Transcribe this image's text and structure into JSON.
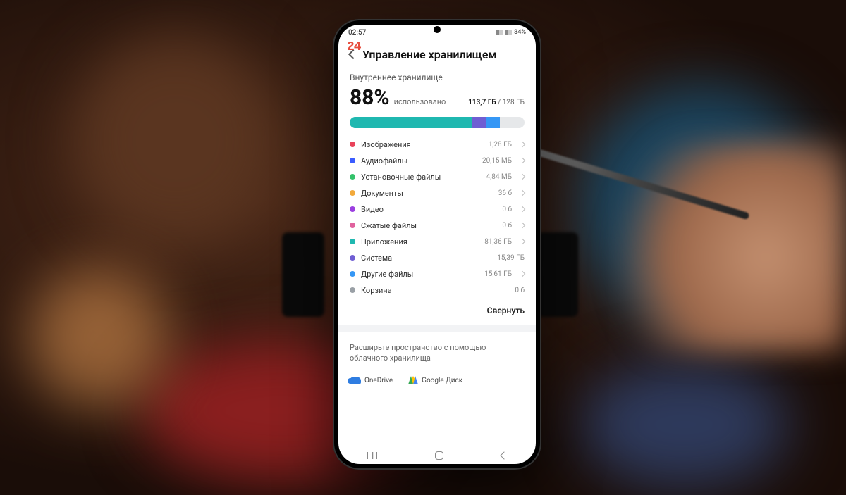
{
  "status_bar": {
    "time": "02:57",
    "battery_text": "84%"
  },
  "overlay_number": "24",
  "page_title": "Управление хранилищем",
  "storage": {
    "section_label": "Внутреннее хранилище",
    "percent": "88%",
    "percent_label": "использовано",
    "used": "113,7 ГБ",
    "separator": " / ",
    "total": "128 ГБ"
  },
  "bar_segments": [
    {
      "color": "#1fb8b0",
      "width": 70
    },
    {
      "color": "#6f5ed3",
      "width": 8
    },
    {
      "color": "#3597f5",
      "width": 8
    }
  ],
  "categories": [
    {
      "color": "#e9425a",
      "label": "Изображения",
      "size": "1,28 ГБ",
      "chevron": true
    },
    {
      "color": "#3a5cff",
      "label": "Аудиофайлы",
      "size": "20,15 МБ",
      "chevron": true
    },
    {
      "color": "#33c26b",
      "label": "Установочные файлы",
      "size": "4,84 МБ",
      "chevron": true
    },
    {
      "color": "#f2a93b",
      "label": "Документы",
      "size": "36 б",
      "chevron": true
    },
    {
      "color": "#9b3fe0",
      "label": "Видео",
      "size": "0 б",
      "chevron": true
    },
    {
      "color": "#e0629e",
      "label": "Сжатые файлы",
      "size": "0 б",
      "chevron": true
    },
    {
      "color": "#1fb8b0",
      "label": "Приложения",
      "size": "81,36 ГБ",
      "chevron": true
    },
    {
      "color": "#6f5ed3",
      "label": "Система",
      "size": "15,39 ГБ",
      "chevron": false
    },
    {
      "color": "#3597f5",
      "label": "Другие файлы",
      "size": "15,61 ГБ",
      "chevron": true
    },
    {
      "color": "#9aa0a6",
      "label": "Корзина",
      "size": "0 б",
      "chevron": false
    }
  ],
  "collapse_label": "Свернуть",
  "cloud_prompt": "Расширьте пространство с помощью облачного хранилища",
  "cloud_services": {
    "onedrive": "OneDrive",
    "gdrive": "Google Диск"
  }
}
